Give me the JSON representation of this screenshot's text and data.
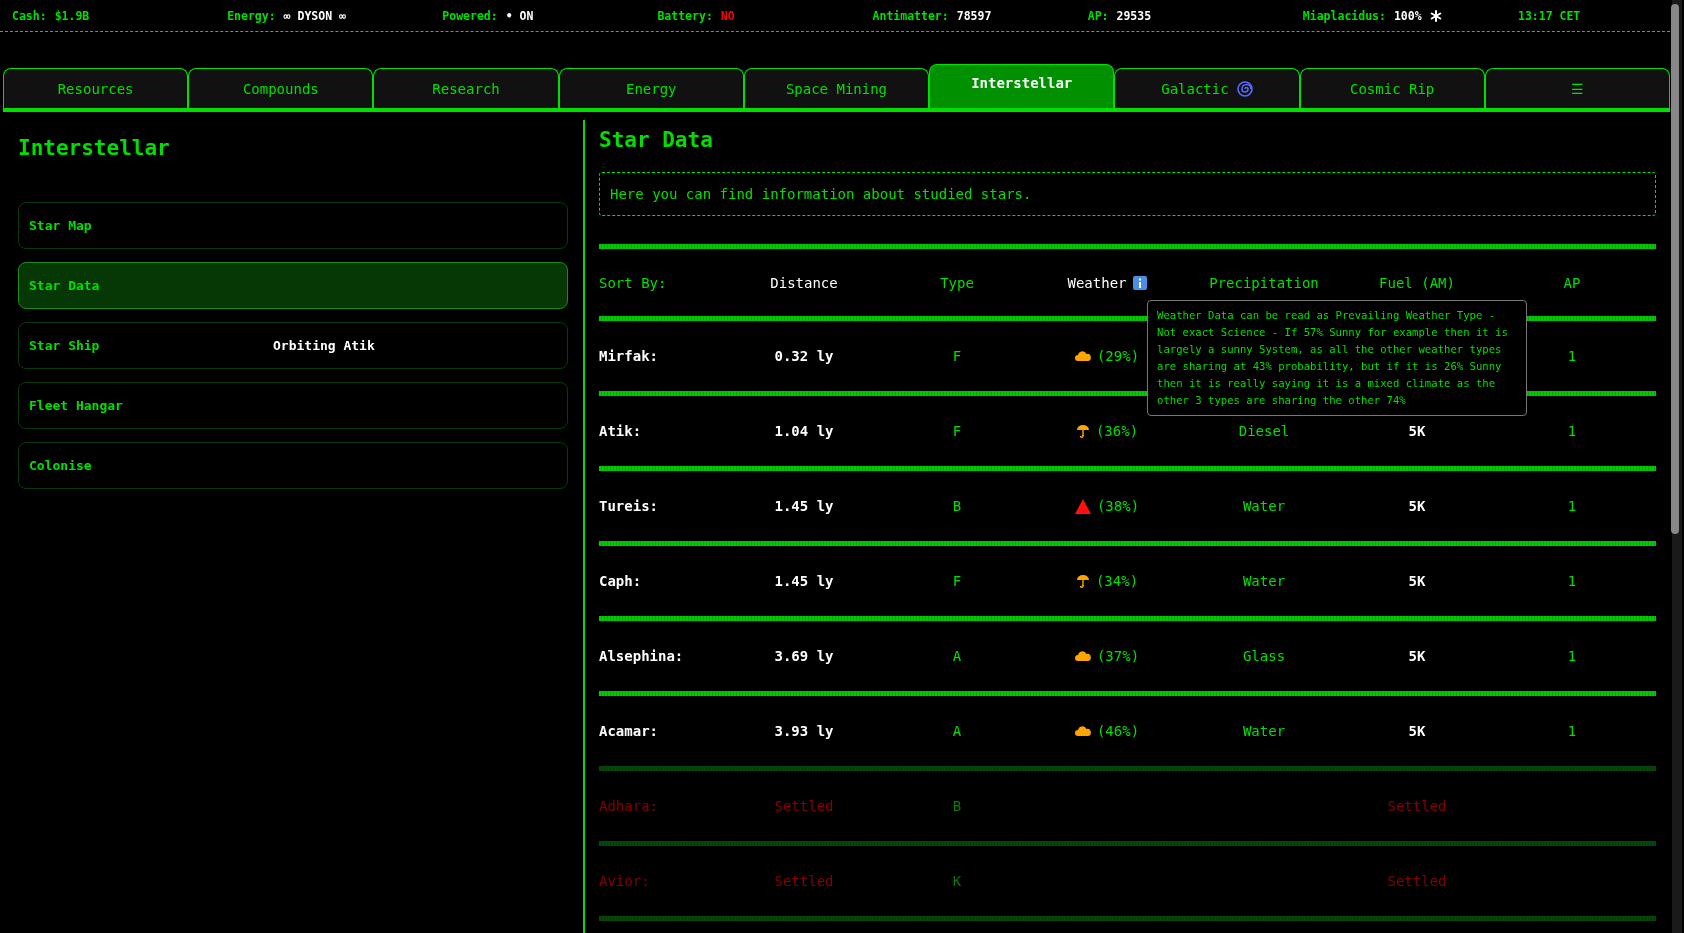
{
  "status_bar": {
    "items": [
      {
        "label": "Cash:",
        "value": "$1.9B",
        "kind": "currency"
      },
      {
        "label": "Energy:",
        "value": "∞ DYSON ∞",
        "kind": "plain"
      },
      {
        "label": "Powered:",
        "value": "• ON",
        "kind": "plain"
      },
      {
        "label": "Battery:",
        "value": "NO",
        "kind": "alert"
      },
      {
        "label": "Antimatter:",
        "value": "78597",
        "kind": "plain"
      },
      {
        "label": "AP:",
        "value": "29535",
        "kind": "plain"
      },
      {
        "label": "Miaplacidus:",
        "value": "100%",
        "kind": "star"
      }
    ],
    "time": "13:17 CET"
  },
  "tabs": [
    {
      "label": "Resources",
      "selected": false,
      "kind": "text"
    },
    {
      "label": "Compounds",
      "selected": false,
      "kind": "text"
    },
    {
      "label": "Research",
      "selected": false,
      "kind": "text"
    },
    {
      "label": "Energy",
      "selected": false,
      "kind": "text"
    },
    {
      "label": "Space Mining",
      "selected": false,
      "kind": "text"
    },
    {
      "label": "Interstellar",
      "selected": true,
      "kind": "text"
    },
    {
      "label": "Galactic",
      "selected": false,
      "kind": "spiral"
    },
    {
      "label": "Cosmic Rip",
      "selected": false,
      "kind": "text"
    },
    {
      "label": "☰",
      "selected": false,
      "kind": "text"
    }
  ],
  "sidebar": {
    "title": "Interstellar",
    "items": [
      {
        "label": "Star Map",
        "selected": false
      },
      {
        "label": "Star Data",
        "selected": true
      },
      {
        "label": "Star Ship",
        "selected": false,
        "status": "Orbiting Atik"
      },
      {
        "label": "Fleet Hangar",
        "selected": false
      },
      {
        "label": "Colonise",
        "selected": false
      }
    ]
  },
  "main": {
    "title": "Star Data",
    "description": "Here you can find information about studied stars.",
    "sort_label": "Sort By:",
    "columns": [
      {
        "label": "Distance",
        "highlighted": true
      },
      {
        "label": "Type",
        "highlighted": false
      },
      {
        "label": "Weather",
        "highlighted": true,
        "info": true
      },
      {
        "label": "Precipitation",
        "highlighted": false
      },
      {
        "label": "Fuel (AM)",
        "highlighted": false
      },
      {
        "label": "AP",
        "highlighted": false
      }
    ],
    "tooltip": "Weather Data can be read as Prevailing Weather Type - Not exact Science - If 57% Sunny for example then it is largely a sunny System, as all the other weather types are sharing at 43% probability, but if it is 26% Sunny then it is really saying it is a mixed climate as the other 3 types are sharing the other 74%",
    "rows": [
      {
        "name": "Mirfak:",
        "distance": "0.32 ly",
        "type": "F",
        "kind": "cloud",
        "weather_pct": "(29%)",
        "ap": "1",
        "settled": false
      },
      {
        "name": "Atik:",
        "distance": "1.04 ly",
        "type": "F",
        "kind": "umbrella",
        "weather_pct": "(36%)",
        "precipitation": "Diesel",
        "fuel": "5K",
        "ap": "1",
        "settled": false
      },
      {
        "name": "Tureis:",
        "distance": "1.45 ly",
        "type": "B",
        "kind": "triangle",
        "weather_pct": "(38%)",
        "precipitation": "Water",
        "fuel": "5K",
        "ap": "1",
        "settled": false
      },
      {
        "name": "Caph:",
        "distance": "1.45 ly",
        "type": "F",
        "kind": "umbrella",
        "weather_pct": "(34%)",
        "precipitation": "Water",
        "fuel": "5K",
        "ap": "1",
        "settled": false
      },
      {
        "name": "Alsephina:",
        "distance": "3.69 ly",
        "type": "A",
        "kind": "cloud",
        "weather_pct": "(37%)",
        "precipitation": "Glass",
        "fuel": "5K",
        "ap": "1",
        "settled": false
      },
      {
        "name": "Acamar:",
        "distance": "3.93 ly",
        "type": "A",
        "kind": "cloud",
        "weather_pct": "(46%)",
        "precipitation": "Water",
        "fuel": "5K",
        "ap": "1",
        "settled": false
      },
      {
        "name": "Adhara:",
        "distance": "Settled",
        "type": "B",
        "fuel": "Settled",
        "settled": true
      },
      {
        "name": "Avior:",
        "distance": "Settled",
        "type": "K",
        "fuel": "Settled",
        "settled": true
      }
    ]
  }
}
